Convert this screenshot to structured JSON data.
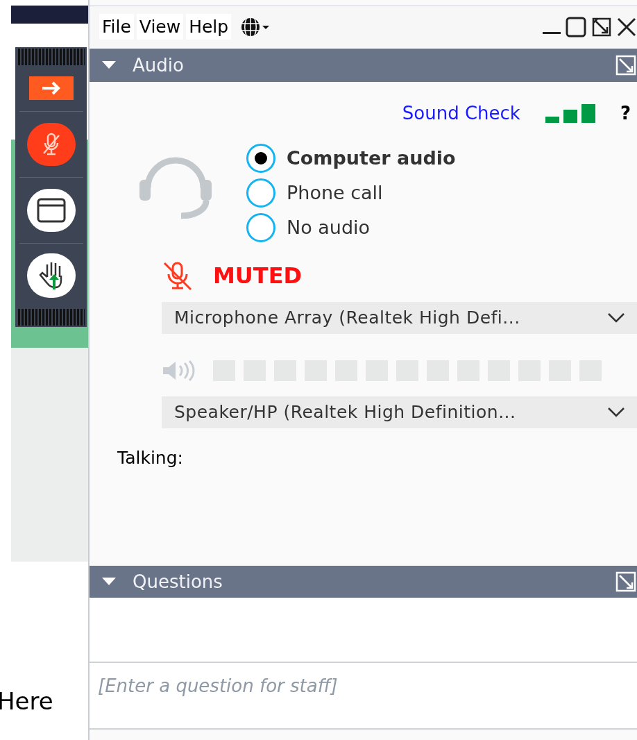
{
  "menu": [
    "File",
    "View",
    "Help"
  ],
  "audio": {
    "title": "Audio",
    "sound_check": "Sound Check",
    "help": "?",
    "options": [
      {
        "label": "Computer audio",
        "selected": true
      },
      {
        "label": "Phone call",
        "selected": false
      },
      {
        "label": "No audio",
        "selected": false
      }
    ],
    "mute_status": "MUTED",
    "microphone": "Microphone Array (Realtek High Defi...",
    "speaker": "Speaker/HP (Realtek High Definition...",
    "talking": "Talking:"
  },
  "questions": {
    "title": "Questions",
    "placeholder": "[Enter a question for staff]"
  },
  "background_text": "Here"
}
